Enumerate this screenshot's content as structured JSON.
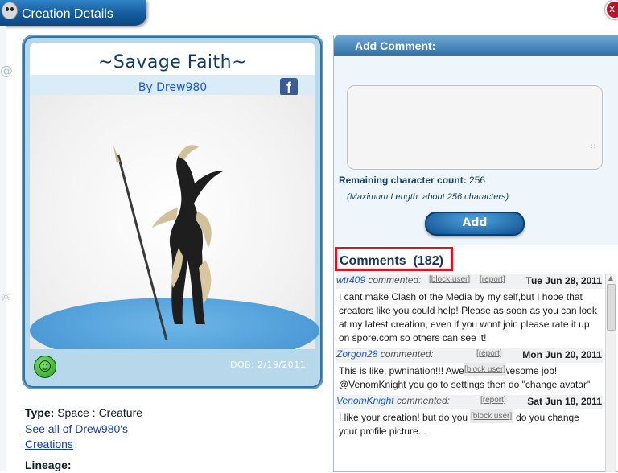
{
  "window": {
    "title": "Creation Details",
    "close_label": "x"
  },
  "card": {
    "title": "~Savage Faith~",
    "byline": "By Drew980",
    "facebook_label": "f",
    "dob": "DOB: 2/19/2011",
    "rating_icon": "smiley-icon"
  },
  "meta": {
    "type_label": "Type:",
    "type_value": "Space : Creature",
    "see_all_link": "See all of Drew980's",
    "creations_link": "Creations",
    "lineage_label": "Lineage:"
  },
  "add_comment": {
    "header": "Add Comment:",
    "textarea_value": "",
    "remaining_label": "Remaining character count:",
    "remaining_value": "256",
    "max_length_note": "(Maximum Length: about 256 characters)",
    "add_button": "Add"
  },
  "comments": {
    "title": "Comments",
    "count": "(182)",
    "items": [
      {
        "author": "wtr409",
        "commented": "commented:",
        "block": "[block user]",
        "report": "[report]",
        "date": "Tue Jun 28, 2011",
        "body": "I cant make Clash of the Media by my self,but I hope that creators like you could help! Please as soon as you can look at my latest creation, even if you wont join please rate it up on spore.com so others can see it!"
      },
      {
        "author": "Zorgon28",
        "commented": "commented:",
        "block": "[block user]",
        "report": "[report]",
        "date": "Mon Jun 20, 2011",
        "body": "This is like, pwnination!!! Awesomely awesome job! @VenomKnight you go to settings then do \"change avatar\""
      },
      {
        "author": "VenomKnight",
        "commented": "commented:",
        "block": "[block user]",
        "report": "[report]",
        "date": "Sat Jun 18, 2011",
        "body": "I like your creation! but do you know how do you change your profile picture..."
      }
    ]
  },
  "colors": {
    "accent": "#145a9c",
    "card_bg": "#b7d7ea",
    "highlight_border": "#e0121b",
    "link": "#1a5bd4"
  }
}
